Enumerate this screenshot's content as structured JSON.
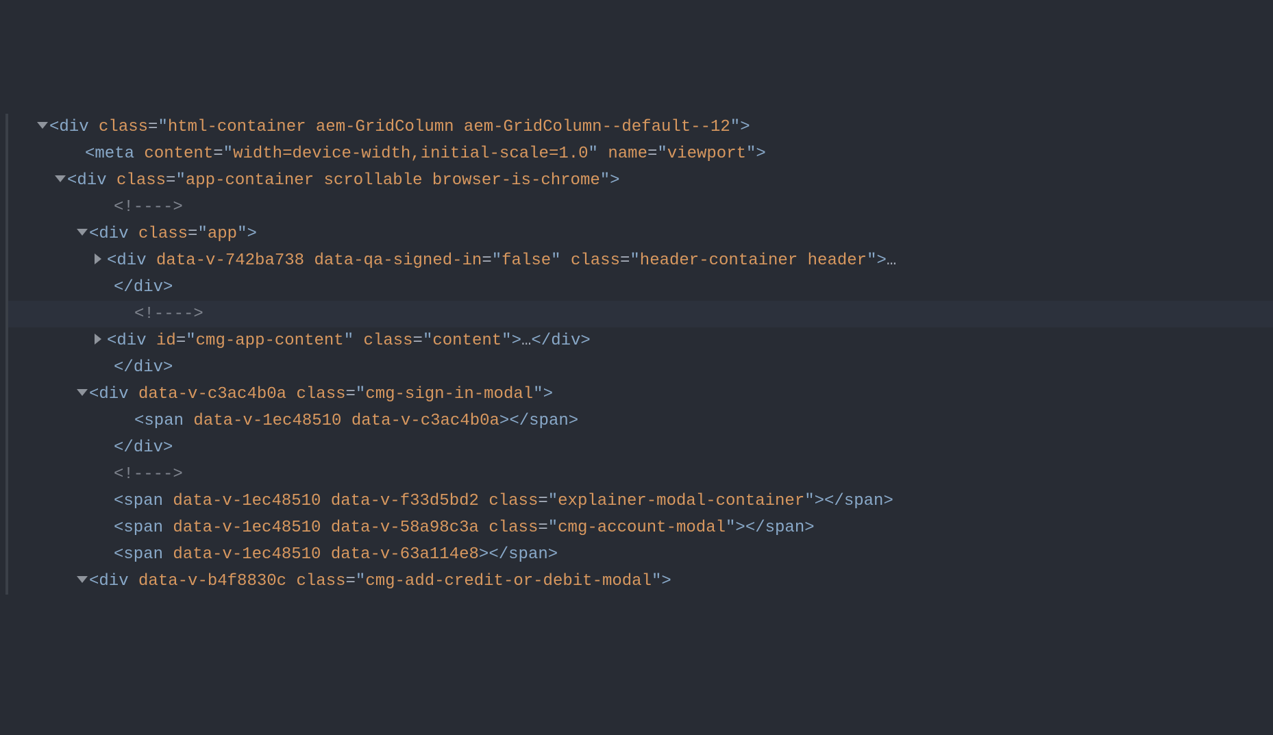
{
  "lines": {
    "l1": {
      "indent": 60,
      "arrow": "down",
      "type": "open",
      "tag": "div",
      "attrs": [
        {
          "name": "class",
          "value": "html-container aem-GridColumn aem-GridColumn--default--12"
        }
      ],
      "selfclose": false,
      "ell": false
    },
    "l2": {
      "indent": 104,
      "arrow": "none",
      "type": "open",
      "tag": "meta",
      "attrs": [
        {
          "name": "content",
          "value": "width=device-width,initial-scale=1.0"
        },
        {
          "name": "name",
          "value": "viewport"
        }
      ],
      "selfclose": true,
      "ell": false
    },
    "l3": {
      "indent": 86,
      "arrow": "down",
      "type": "open",
      "tag": "div",
      "attrs": [
        {
          "name": "class",
          "value": "app-container scrollable browser-is-chrome"
        }
      ],
      "selfclose": false,
      "ell": false
    },
    "l4": {
      "indent": 146,
      "arrow": "none",
      "type": "comment",
      "text": "<!---->"
    },
    "l5": {
      "indent": 118,
      "arrow": "down",
      "type": "open",
      "tag": "div",
      "attrs": [
        {
          "name": "class",
          "value": "app"
        }
      ],
      "selfclose": false,
      "ell": false
    },
    "l6": {
      "indent": 144,
      "arrow": "right",
      "type": "open",
      "tag": "div",
      "attrs": [
        {
          "name": "data-v-742ba738",
          "value": null
        },
        {
          "name": "data-qa-signed-in",
          "value": "false"
        },
        {
          "name": "class",
          "value": "header-container header"
        }
      ],
      "selfclose": false,
      "ell": true
    },
    "l6b": {
      "indent": 146,
      "arrow": "none",
      "type": "close",
      "tag": "div"
    },
    "l7": {
      "indent": 176,
      "arrow": "none",
      "type": "comment",
      "text": "<!---->",
      "highlight": true
    },
    "l8": {
      "indent": 144,
      "arrow": "right",
      "type": "openclose",
      "tag": "div",
      "attrs": [
        {
          "name": "id",
          "value": "cmg-app-content"
        },
        {
          "name": "class",
          "value": "content"
        }
      ],
      "ell": true,
      "closetag": "div"
    },
    "l9": {
      "indent": 146,
      "arrow": "none",
      "type": "close",
      "tag": "div"
    },
    "l10": {
      "indent": 118,
      "arrow": "down",
      "type": "open",
      "tag": "div",
      "attrs": [
        {
          "name": "data-v-c3ac4b0a",
          "value": null
        },
        {
          "name": "class",
          "value": "cmg-sign-in-modal"
        }
      ],
      "selfclose": false,
      "ell": false
    },
    "l11": {
      "indent": 176,
      "arrow": "none",
      "type": "openclose",
      "tag": "span",
      "attrs": [
        {
          "name": "data-v-1ec48510",
          "value": null
        },
        {
          "name": "data-v-c3ac4b0a",
          "value": null
        }
      ],
      "ell": false,
      "closetag": "span"
    },
    "l12": {
      "indent": 146,
      "arrow": "none",
      "type": "close",
      "tag": "div"
    },
    "l13": {
      "indent": 146,
      "arrow": "none",
      "type": "comment",
      "text": "<!---->"
    },
    "l14": {
      "indent": 146,
      "arrow": "none",
      "type": "openclose",
      "tag": "span",
      "attrs": [
        {
          "name": "data-v-1ec48510",
          "value": null
        },
        {
          "name": "data-v-f33d5bd2",
          "value": null
        },
        {
          "name": "class",
          "value": "explainer-modal-container"
        }
      ],
      "ell": false,
      "closetag": "span"
    },
    "l15": {
      "indent": 146,
      "arrow": "none",
      "type": "openclose",
      "tag": "span",
      "attrs": [
        {
          "name": "data-v-1ec48510",
          "value": null
        },
        {
          "name": "data-v-58a98c3a",
          "value": null
        },
        {
          "name": "class",
          "value": "cmg-account-modal"
        }
      ],
      "ell": false,
      "closetag": "span"
    },
    "l16": {
      "indent": 146,
      "arrow": "none",
      "type": "openclose",
      "tag": "span",
      "attrs": [
        {
          "name": "data-v-1ec48510",
          "value": null
        },
        {
          "name": "data-v-63a114e8",
          "value": null
        }
      ],
      "ell": false,
      "closetag": "span"
    },
    "l17": {
      "indent": 118,
      "arrow": "down",
      "type": "open",
      "tag": "div",
      "attrs": [
        {
          "name": "data-v-b4f8830c",
          "value": null
        },
        {
          "name": "class",
          "value": "cmg-add-credit-or-debit-modal"
        }
      ],
      "selfclose": false,
      "ell": false
    }
  },
  "order": [
    "l1",
    "l2",
    "l3",
    "l4",
    "l5",
    "l6",
    "l6b",
    "l7",
    "l8",
    "l9",
    "l10",
    "l11",
    "l12",
    "l13",
    "l14",
    "l15",
    "l16",
    "l17"
  ]
}
